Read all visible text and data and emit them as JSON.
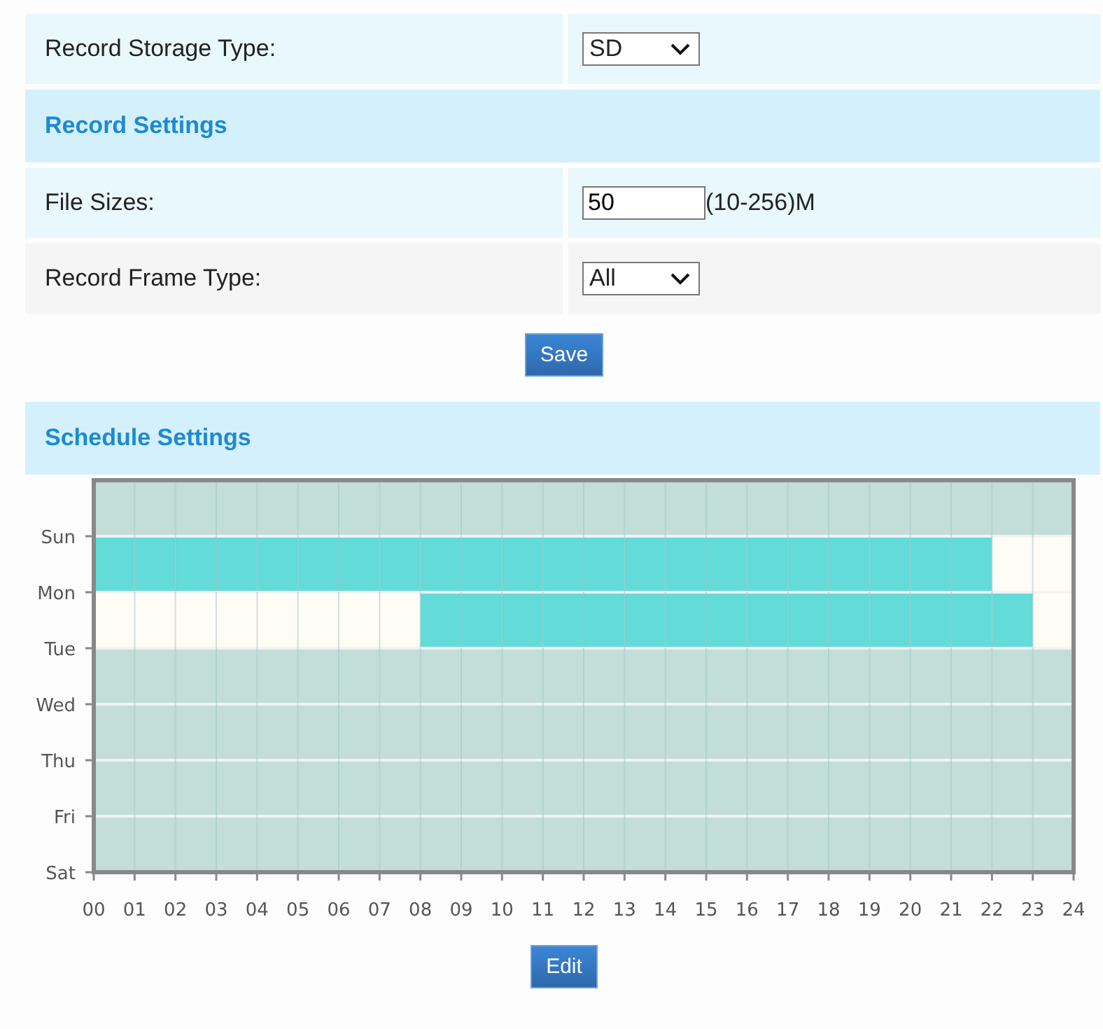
{
  "storage": {
    "label": "Record Storage Type:",
    "value": "SD"
  },
  "record_settings": {
    "title": "Record Settings",
    "rows": [
      {
        "kind": "input",
        "label": "File Sizes:",
        "value": "50",
        "hint": "(10-256)M"
      },
      {
        "kind": "select",
        "label": "Record Frame Type:",
        "value": "All"
      }
    ],
    "save": "Save"
  },
  "schedule": {
    "title": "Schedule Settings",
    "day_labels": [
      "Sun",
      "Mon",
      "Tue",
      "Wed",
      "Thu",
      "Fri",
      "Sat"
    ],
    "hour_labels": [
      "00",
      "01",
      "02",
      "03",
      "04",
      "05",
      "06",
      "07",
      "08",
      "09",
      "10",
      "11",
      "12",
      "13",
      "14",
      "15",
      "16",
      "17",
      "18",
      "19",
      "20",
      "21",
      "22",
      "23",
      "24"
    ],
    "rows": [
      {
        "highlighted": false,
        "hours": [
          false,
          false,
          false,
          false,
          false,
          false,
          false,
          false,
          false,
          false,
          false,
          false,
          false,
          false,
          false,
          false,
          false,
          false,
          false,
          false,
          false,
          false,
          false,
          false
        ]
      },
      {
        "highlighted": true,
        "hours": [
          true,
          true,
          true,
          true,
          true,
          true,
          true,
          true,
          true,
          true,
          true,
          true,
          true,
          true,
          true,
          true,
          true,
          true,
          true,
          true,
          true,
          true,
          false,
          false
        ]
      },
      {
        "highlighted": true,
        "hours": [
          false,
          false,
          false,
          false,
          false,
          false,
          false,
          false,
          true,
          true,
          true,
          true,
          true,
          true,
          true,
          true,
          true,
          true,
          true,
          true,
          true,
          true,
          true,
          false
        ]
      },
      {
        "highlighted": false,
        "hours": [
          false,
          false,
          false,
          false,
          false,
          false,
          false,
          false,
          false,
          false,
          false,
          false,
          false,
          false,
          false,
          false,
          false,
          false,
          false,
          false,
          false,
          false,
          false,
          false
        ]
      },
      {
        "highlighted": false,
        "hours": [
          false,
          false,
          false,
          false,
          false,
          false,
          false,
          false,
          false,
          false,
          false,
          false,
          false,
          false,
          false,
          false,
          false,
          false,
          false,
          false,
          false,
          false,
          false,
          false
        ]
      },
      {
        "highlighted": false,
        "hours": [
          false,
          false,
          false,
          false,
          false,
          false,
          false,
          false,
          false,
          false,
          false,
          false,
          false,
          false,
          false,
          false,
          false,
          false,
          false,
          false,
          false,
          false,
          false,
          false
        ]
      },
      {
        "highlighted": false,
        "hours": [
          false,
          false,
          false,
          false,
          false,
          false,
          false,
          false,
          false,
          false,
          false,
          false,
          false,
          false,
          false,
          false,
          false,
          false,
          false,
          false,
          false,
          false,
          false,
          false
        ]
      }
    ],
    "edit": "Edit"
  }
}
